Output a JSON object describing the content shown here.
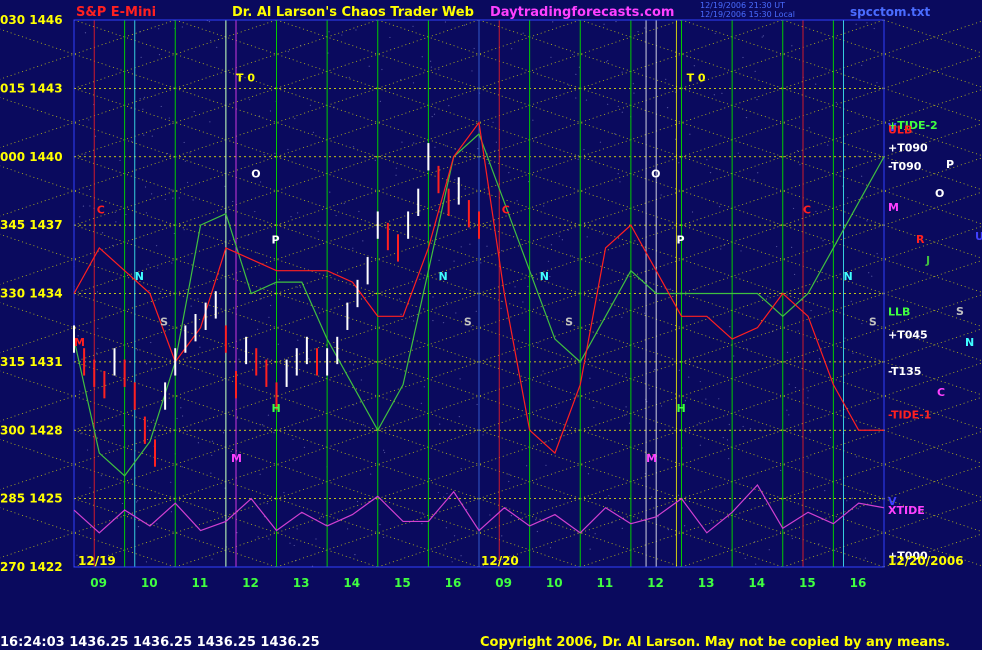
{
  "header": {
    "symbol": "S&P E-Mini",
    "title": "Dr. Al Larson's Chaos Trader Web",
    "site": "Daytradingforecasts.com",
    "timestamp1": "12/19/2006 21:30 UT",
    "timestamp2": "12/19/2006 15:30 Local",
    "file": "spcctom.txt"
  },
  "footer": {
    "quote": "16:24:03  1436.25 1436.25 1436.25 1436.25",
    "copyright": "Copyright 2006, Dr. Al Larson. May not be copied by any means."
  },
  "date_labels": {
    "start": "12/19",
    "mid": "12/20",
    "end": "12/20/2006"
  },
  "colors": {
    "background": "#0a0a5e",
    "grid_h": "#ffff00",
    "grid_v": "#00cc00",
    "price_up": "#ffffff",
    "price_down": "#ff2020",
    "red_line": "#ff2020",
    "green_line": "#40c040",
    "xtide": "#d040d0"
  },
  "chart_data": {
    "type": "line",
    "title": "S&P E-Mini",
    "y_axis": {
      "labels": [
        {
          "angle": "030",
          "price": 1446
        },
        {
          "angle": "015",
          "price": 1443
        },
        {
          "angle": "000",
          "price": 1440
        },
        {
          "angle": "345",
          "price": 1437
        },
        {
          "angle": "330",
          "price": 1434
        },
        {
          "angle": "315",
          "price": 1431
        },
        {
          "angle": "300",
          "price": 1428
        },
        {
          "angle": "285",
          "price": 1425
        },
        {
          "angle": "270",
          "price": 1422
        }
      ],
      "ylim": [
        1422,
        1446
      ]
    },
    "x_axis": {
      "tick_labels": [
        "09",
        "10",
        "11",
        "12",
        "13",
        "14",
        "15",
        "16",
        "09",
        "10",
        "11",
        "12",
        "13",
        "14",
        "15",
        "16"
      ],
      "xlim": [
        0,
        16
      ]
    },
    "grid": true,
    "price_series": {
      "name": "S&P E-Mini",
      "x": [
        0,
        0.2,
        0.4,
        0.6,
        0.8,
        1.0,
        1.2,
        1.4,
        1.6,
        1.8,
        2.0,
        2.2,
        2.4,
        2.6,
        2.8,
        3.0,
        3.2,
        3.4,
        3.6,
        3.8,
        4.0,
        4.2,
        4.4,
        4.6,
        4.8,
        5.0,
        5.2,
        5.4,
        5.6,
        5.8,
        6.0,
        6.2,
        6.4,
        6.6,
        6.8,
        7.0,
        7.2,
        7.4,
        7.6,
        7.8,
        8.0
      ],
      "y": [
        1432,
        1431,
        1430.5,
        1430,
        1431,
        1430.5,
        1429.5,
        1428,
        1427,
        1429.5,
        1431,
        1432,
        1432.5,
        1433,
        1433.5,
        1432,
        1430,
        1431.5,
        1431,
        1430.5,
        1429.5,
        1430.5,
        1431,
        1431.5,
        1431,
        1431,
        1431.5,
        1433,
        1434,
        1435,
        1437,
        1436.5,
        1436,
        1437,
        1438,
        1440,
        1439,
        1438,
        1438.5,
        1437.5,
        1437
      ]
    },
    "green_line": {
      "name": "",
      "x": [
        0,
        0.5,
        1,
        1.5,
        2,
        2.5,
        3,
        3.5,
        4,
        4.5,
        5,
        5.5,
        6,
        6.5,
        7,
        7.5,
        8,
        8.5,
        9,
        9.5,
        10,
        10.5,
        11,
        11.5,
        12,
        12.5,
        13,
        13.5,
        14,
        14.5,
        15,
        15.5,
        16
      ],
      "y": [
        1432,
        1427,
        1426,
        1427.5,
        1431,
        1437,
        1437.5,
        1434,
        1434.5,
        1434.5,
        1432,
        1430,
        1428,
        1430,
        1435,
        1440,
        1441,
        1438,
        1435,
        1432,
        1431,
        1433,
        1435,
        1434,
        1434,
        1434,
        1434,
        1434,
        1433,
        1434,
        1436,
        1438,
        1440
      ]
    },
    "red_line": {
      "name": "",
      "x": [
        0,
        0.5,
        1,
        1.5,
        2,
        2.5,
        3,
        3.5,
        4,
        4.5,
        5,
        5.5,
        6,
        6.5,
        7,
        7.5,
        8,
        8.5,
        9,
        9.5,
        10,
        10.5,
        11,
        11.5,
        12,
        12.5,
        13,
        13.5,
        14,
        14.5,
        15,
        15.5,
        16
      ],
      "y": [
        1434,
        1436,
        1435,
        1434,
        1431,
        1432.5,
        1436,
        1435.5,
        1435,
        1435,
        1435,
        1434.5,
        1433,
        1433,
        1436,
        1440,
        1441.5,
        1434,
        1428,
        1427,
        1430,
        1436,
        1437,
        1435,
        1433,
        1433,
        1432,
        1432.5,
        1434,
        1433,
        1430,
        1428,
        1428
      ]
    },
    "xtide": {
      "name": "XTIDE",
      "x": [
        0,
        0.5,
        1,
        1.5,
        2,
        2.5,
        3,
        3.5,
        4,
        4.5,
        5,
        5.5,
        6,
        6.5,
        7,
        7.5,
        8,
        8.5,
        9,
        9.5,
        10,
        10.5,
        11,
        11.5,
        12,
        12.5,
        13,
        13.5,
        14,
        14.5,
        15,
        15.5,
        16
      ],
      "y": [
        1424.5,
        1423.5,
        1424.5,
        1423.8,
        1424.8,
        1423.6,
        1424,
        1425,
        1423.6,
        1424.4,
        1423.8,
        1424.3,
        1425.1,
        1424,
        1424,
        1425.3,
        1423.6,
        1424.6,
        1423.8,
        1424.3,
        1423.5,
        1424.6,
        1423.9,
        1424.2,
        1425,
        1423.5,
        1424.4,
        1425.6,
        1423.7,
        1424.4,
        1423.9,
        1424.8,
        1424.6
      ]
    },
    "right_labels": [
      {
        "text": "V",
        "y": 1441.3,
        "color": "#4040ff"
      },
      {
        "text": "+TIDE-2",
        "y": 1441.4,
        "color": "#40ff40"
      },
      {
        "text": "ULB",
        "y": 1441.2,
        "color": "#ff2020"
      },
      {
        "text": "+T090",
        "y": 1440.4,
        "color": "#ffffff"
      },
      {
        "text": "-T090",
        "y": 1439.6,
        "color": "#ffffff"
      },
      {
        "text": "M",
        "y": 1437.8,
        "color": "#ff40ff"
      },
      {
        "text": "LLB",
        "y": 1433.2,
        "color": "#40ff40"
      },
      {
        "text": "+T045",
        "y": 1432.2,
        "color": "#ffffff"
      },
      {
        "text": "-T135",
        "y": 1430.6,
        "color": "#ffffff"
      },
      {
        "text": "-TIDE-1",
        "y": 1428.7,
        "color": "#ff2020"
      },
      {
        "text": "V",
        "y": 1424.9,
        "color": "#4040ff"
      },
      {
        "text": "XTIDE",
        "y": 1424.5,
        "color": "#ff40ff"
      },
      {
        "text": "+T000",
        "y": 1422.5,
        "color": "#ffffff"
      }
    ],
    "far_right_labels": [
      {
        "text": "P",
        "color": "#ffffff"
      },
      {
        "text": "O",
        "color": "#ffffff"
      },
      {
        "text": "R",
        "color": "#ff2020"
      },
      {
        "text": "U",
        "color": "#4040ff"
      },
      {
        "text": "J",
        "color": "#40c040"
      },
      {
        "text": "S",
        "color": "#c0c0c0"
      },
      {
        "text": "N",
        "color": "#40ffff"
      },
      {
        "text": "C",
        "color": "#ff40ff"
      }
    ],
    "chart_letters": [
      {
        "text": "T 0",
        "color": "#ffff00",
        "x": 3.2,
        "y": 1443.3
      },
      {
        "text": "T 0",
        "color": "#ffff00",
        "x": 12.1,
        "y": 1443.3
      },
      {
        "text": "O",
        "color": "#ffffff",
        "x": 3.5,
        "y": 1439.1
      },
      {
        "text": "O",
        "color": "#ffffff",
        "x": 11.4,
        "y": 1439.1
      },
      {
        "text": "C",
        "color": "#ff2020",
        "x": 0.45,
        "y": 1437.5
      },
      {
        "text": "C",
        "color": "#ff2020",
        "x": 8.45,
        "y": 1437.5
      },
      {
        "text": "C",
        "color": "#ff2020",
        "x": 14.4,
        "y": 1437.5
      },
      {
        "text": "P",
        "color": "#ffffff",
        "x": 3.9,
        "y": 1436.2
      },
      {
        "text": "P",
        "color": "#ffffff",
        "x": 11.9,
        "y": 1436.2
      },
      {
        "text": "N",
        "color": "#40ffff",
        "x": 1.2,
        "y": 1434.6
      },
      {
        "text": "N",
        "color": "#40ffff",
        "x": 7.2,
        "y": 1434.6
      },
      {
        "text": "N",
        "color": "#40ffff",
        "x": 9.2,
        "y": 1434.6
      },
      {
        "text": "N",
        "color": "#40ffff",
        "x": 15.2,
        "y": 1434.6
      },
      {
        "text": "S",
        "color": "#c0c0c0",
        "x": 1.7,
        "y": 1432.6
      },
      {
        "text": "S",
        "color": "#c0c0c0",
        "x": 7.7,
        "y": 1432.6
      },
      {
        "text": "S",
        "color": "#c0c0c0",
        "x": 9.7,
        "y": 1432.6
      },
      {
        "text": "S",
        "color": "#c0c0c0",
        "x": 15.7,
        "y": 1432.6
      },
      {
        "text": "M",
        "color": "#ff2020",
        "x": 0.0,
        "y": 1431.7
      },
      {
        "text": "H",
        "color": "#40ff40",
        "x": 3.9,
        "y": 1428.8
      },
      {
        "text": "H",
        "color": "#40ff40",
        "x": 11.9,
        "y": 1428.8
      },
      {
        "text": "M",
        "color": "#ff40ff",
        "x": 3.1,
        "y": 1426.6
      },
      {
        "text": "M",
        "color": "#ff40ff",
        "x": 11.3,
        "y": 1426.6
      }
    ]
  }
}
